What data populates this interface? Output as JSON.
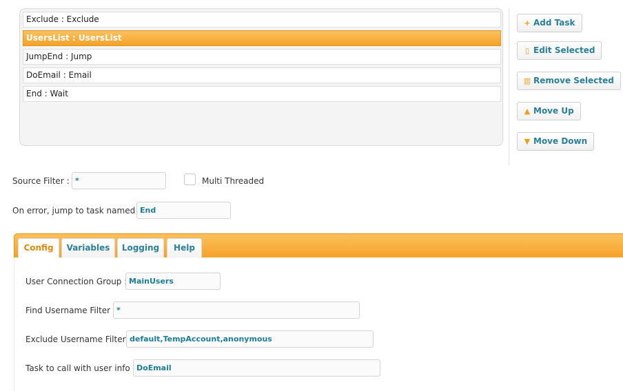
{
  "tasks": [
    {
      "label": "Exclude : Exclude"
    },
    {
      "label": "UsersList : UsersList"
    },
    {
      "label": "JumpEnd : Jump"
    },
    {
      "label": "DoEmail : Email"
    },
    {
      "label": "End : Wait"
    }
  ],
  "selected_task": "UsersList : UsersList",
  "buttons": {
    "add": "Add Task",
    "edit": "Edit Selected",
    "remove": "Remove Selected",
    "up": "Move Up",
    "down": "Move Down"
  },
  "icons": {
    "add": "plus-icon",
    "edit": "document-icon",
    "remove": "trash-icon",
    "up": "triangle-up-icon",
    "down": "triangle-down-icon"
  },
  "source_filter": {
    "label": "Source Filter :",
    "value": "*"
  },
  "multi_threaded": {
    "label": "Multi Threaded",
    "checked": false
  },
  "on_error": {
    "label": "On error, jump to task named :",
    "value": "End"
  },
  "tabs": {
    "config": "Config",
    "variables": "Variables",
    "logging": "Logging",
    "help": "Help",
    "active": "Config"
  },
  "config": {
    "user_connection_group": {
      "label": "User Connection Group :",
      "value": "MainUsers"
    },
    "find_username_filter": {
      "label": "Find Username Filter :",
      "value": "*"
    },
    "exclude_username_filter": {
      "label": "Exclude Username Filter :",
      "value": "default,TempAccount,anonymous"
    },
    "task_to_call": {
      "label": "Task to call with user info :",
      "value": "DoEmail"
    }
  },
  "colors": {
    "accent": "#f5a22a",
    "link": "#2a7f9b",
    "active_tab_text": "#e0890f"
  }
}
